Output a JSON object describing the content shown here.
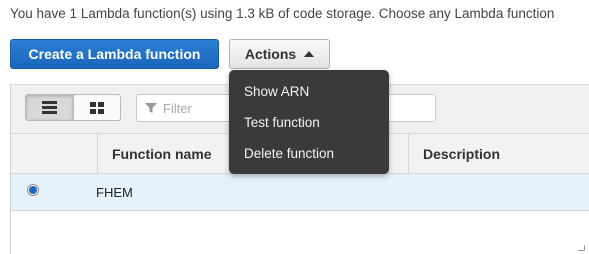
{
  "intro_text": "You have 1 Lambda function(s) using 1.3 kB of code storage. Choose any Lambda function",
  "create_button_label": "Create a Lambda function",
  "actions_button_label": "Actions",
  "actions_menu": {
    "items": [
      {
        "label": "Show ARN"
      },
      {
        "label": "Test function"
      },
      {
        "label": "Delete function"
      }
    ]
  },
  "view_toggle": {
    "list_icon": "list-view-icon",
    "grid_icon": "grid-view-icon",
    "active": "list"
  },
  "filter": {
    "placeholder": "Filter",
    "value": "",
    "icon": "filter-funnel-icon"
  },
  "table": {
    "columns": [
      "Function name",
      "Description"
    ],
    "rows": [
      {
        "selected": true,
        "function_name": "FHEM",
        "description": ""
      }
    ]
  },
  "colors": {
    "primary_button": "#1a66bd",
    "selected_row": "#e5f1fb",
    "menu_background": "#3a3a3a",
    "radio_selected": "#1f66c1"
  }
}
